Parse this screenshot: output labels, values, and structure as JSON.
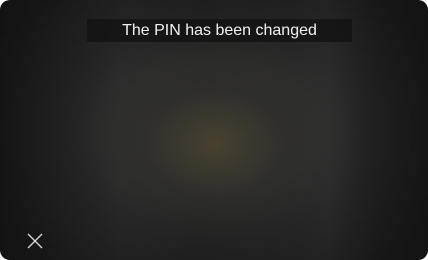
{
  "notification": {
    "message": "The PIN has been changed"
  },
  "controls": {
    "close_icon": "close-icon",
    "close_color": "#d9d9d9"
  },
  "colors": {
    "background": "#1f1f1f",
    "toast_background": "#121212",
    "text": "#f2f2f2"
  }
}
